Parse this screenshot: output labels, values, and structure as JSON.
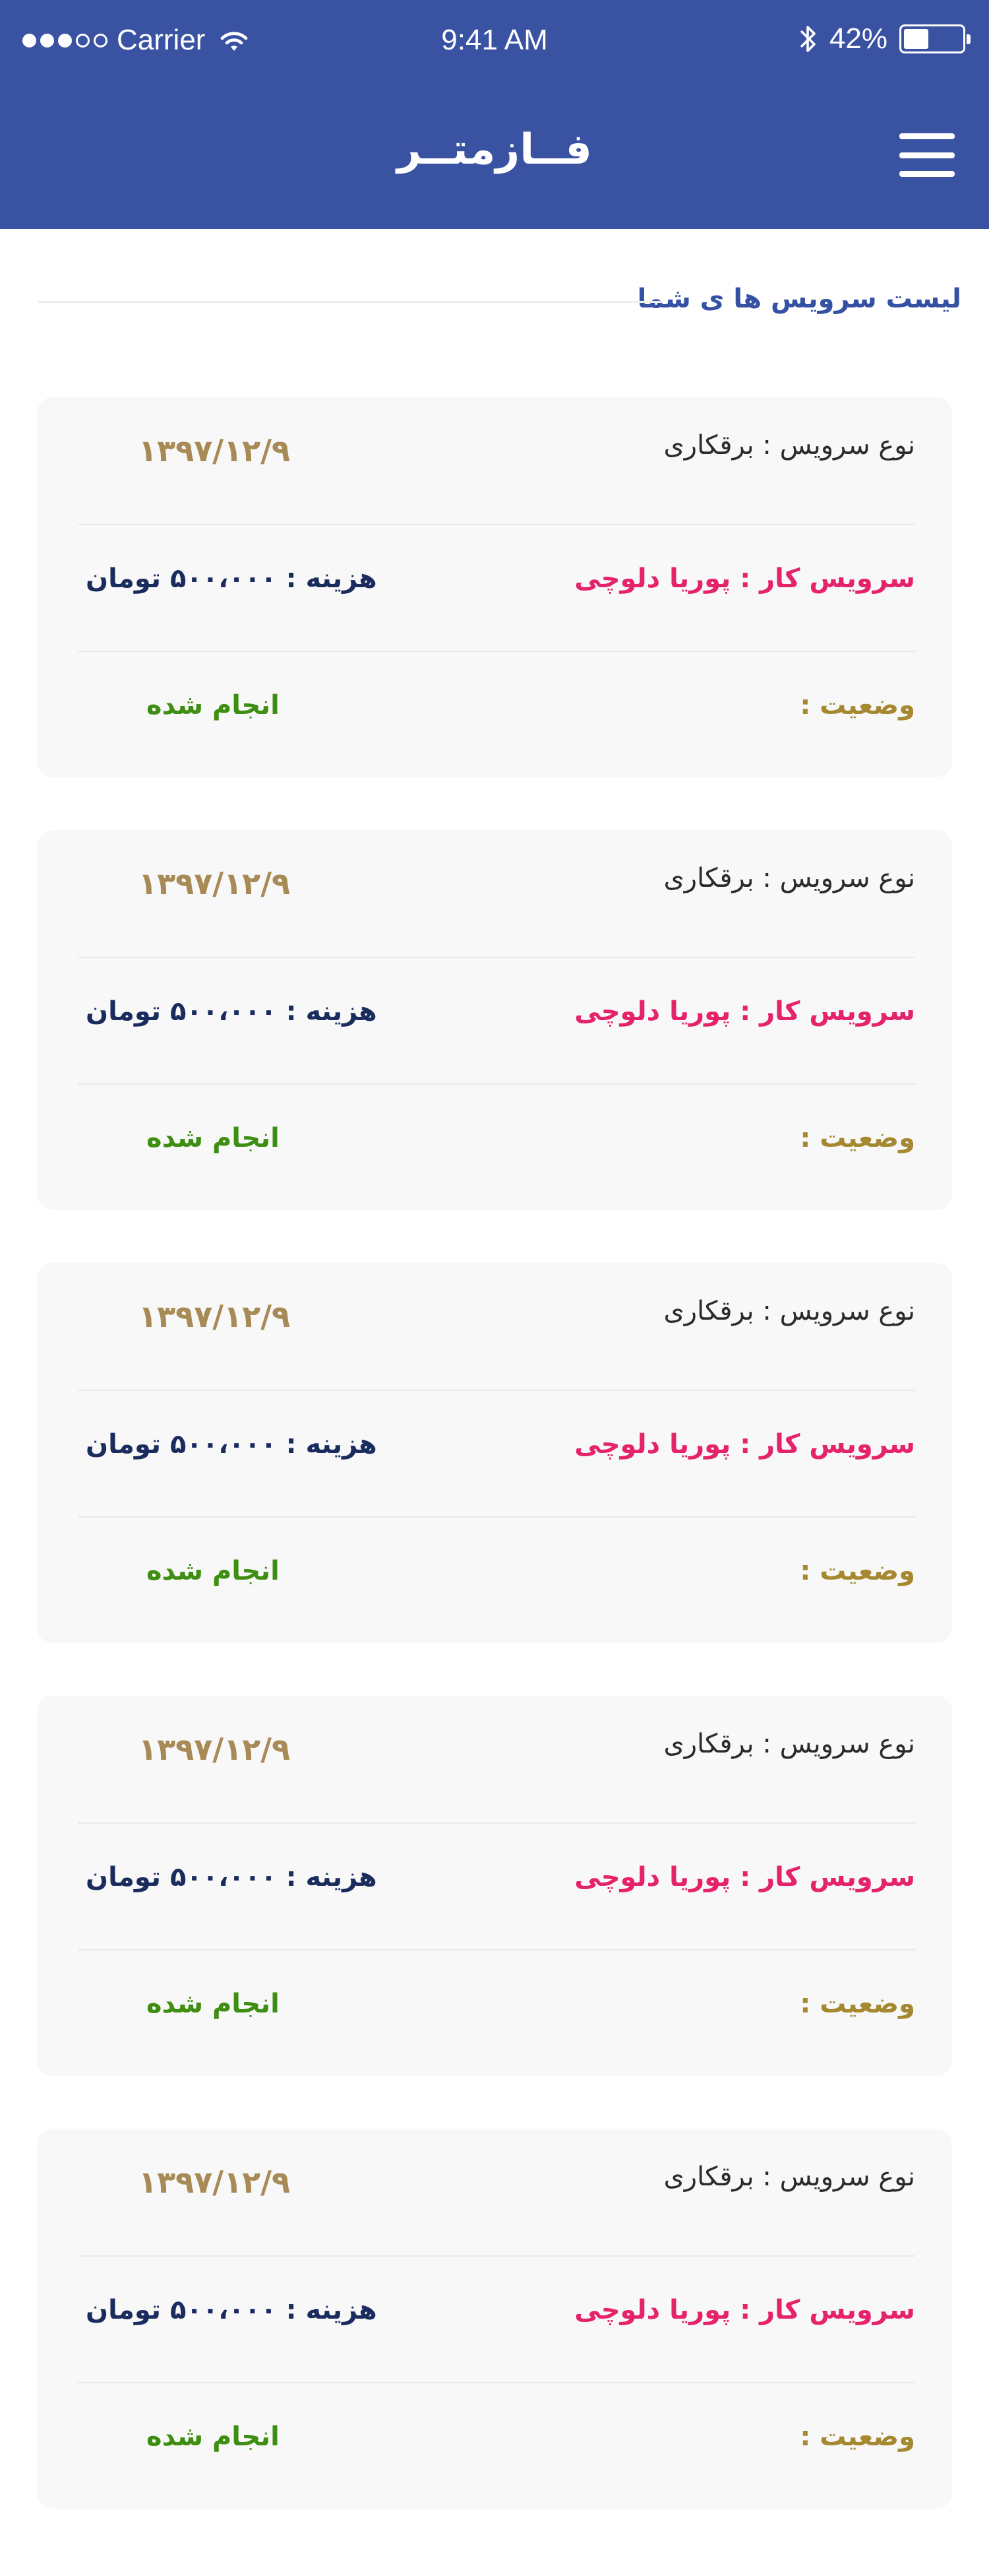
{
  "status_bar": {
    "carrier": "Carrier",
    "time": "9:41 AM",
    "battery_percent": "42%",
    "battery_level": 0.42,
    "signal_strength": 3,
    "signal_max": 5
  },
  "header": {
    "title": "فــازمتــر",
    "menu_icon": "hamburger-menu-icon",
    "background_color": "#3952a2"
  },
  "section": {
    "title": "لیست سرویس ها ی شما"
  },
  "services": [
    {
      "type": "نوع سرویس : برقکاری",
      "date": "۱۳۹۷/۱۲/۹",
      "technician": "سرویس کار : پوریا دلوچی",
      "cost": "هزینه : ۵۰۰،۰۰۰ تومان",
      "status_label": "وضعیت :",
      "status_value": "انجام شده"
    },
    {
      "type": "نوع سرویس : برقکاری",
      "date": "۱۳۹۷/۱۲/۹",
      "technician": "سرویس کار : پوریا دلوچی",
      "cost": "هزینه : ۵۰۰،۰۰۰ تومان",
      "status_label": "وضعیت :",
      "status_value": "انجام شده"
    },
    {
      "type": "نوع سرویس : برقکاری",
      "date": "۱۳۹۷/۱۲/۹",
      "technician": "سرویس کار : پوریا دلوچی",
      "cost": "هزینه : ۵۰۰،۰۰۰ تومان",
      "status_label": "وضعیت :",
      "status_value": "انجام شده"
    },
    {
      "type": "نوع سرویس : برقکاری",
      "date": "۱۳۹۷/۱۲/۹",
      "technician": "سرویس کار : پوریا دلوچی",
      "cost": "هزینه : ۵۰۰،۰۰۰ تومان",
      "status_label": "وضعیت :",
      "status_value": "انجام شده"
    },
    {
      "type": "نوع سرویس : برقکاری",
      "date": "۱۳۹۷/۱۲/۹",
      "technician": "سرویس کار : پوریا دلوچی",
      "cost": "هزینه : ۵۰۰،۰۰۰ تومان",
      "status_label": "وضعیت :",
      "status_value": "انجام شده"
    }
  ],
  "colors": {
    "accent": "#3952a2",
    "technician": "#e5236b",
    "cost": "#1a2c5e",
    "date": "#a78a55",
    "status_label": "#a58830",
    "status_done": "#3e8e12",
    "card_background": "#f8f8f8"
  }
}
